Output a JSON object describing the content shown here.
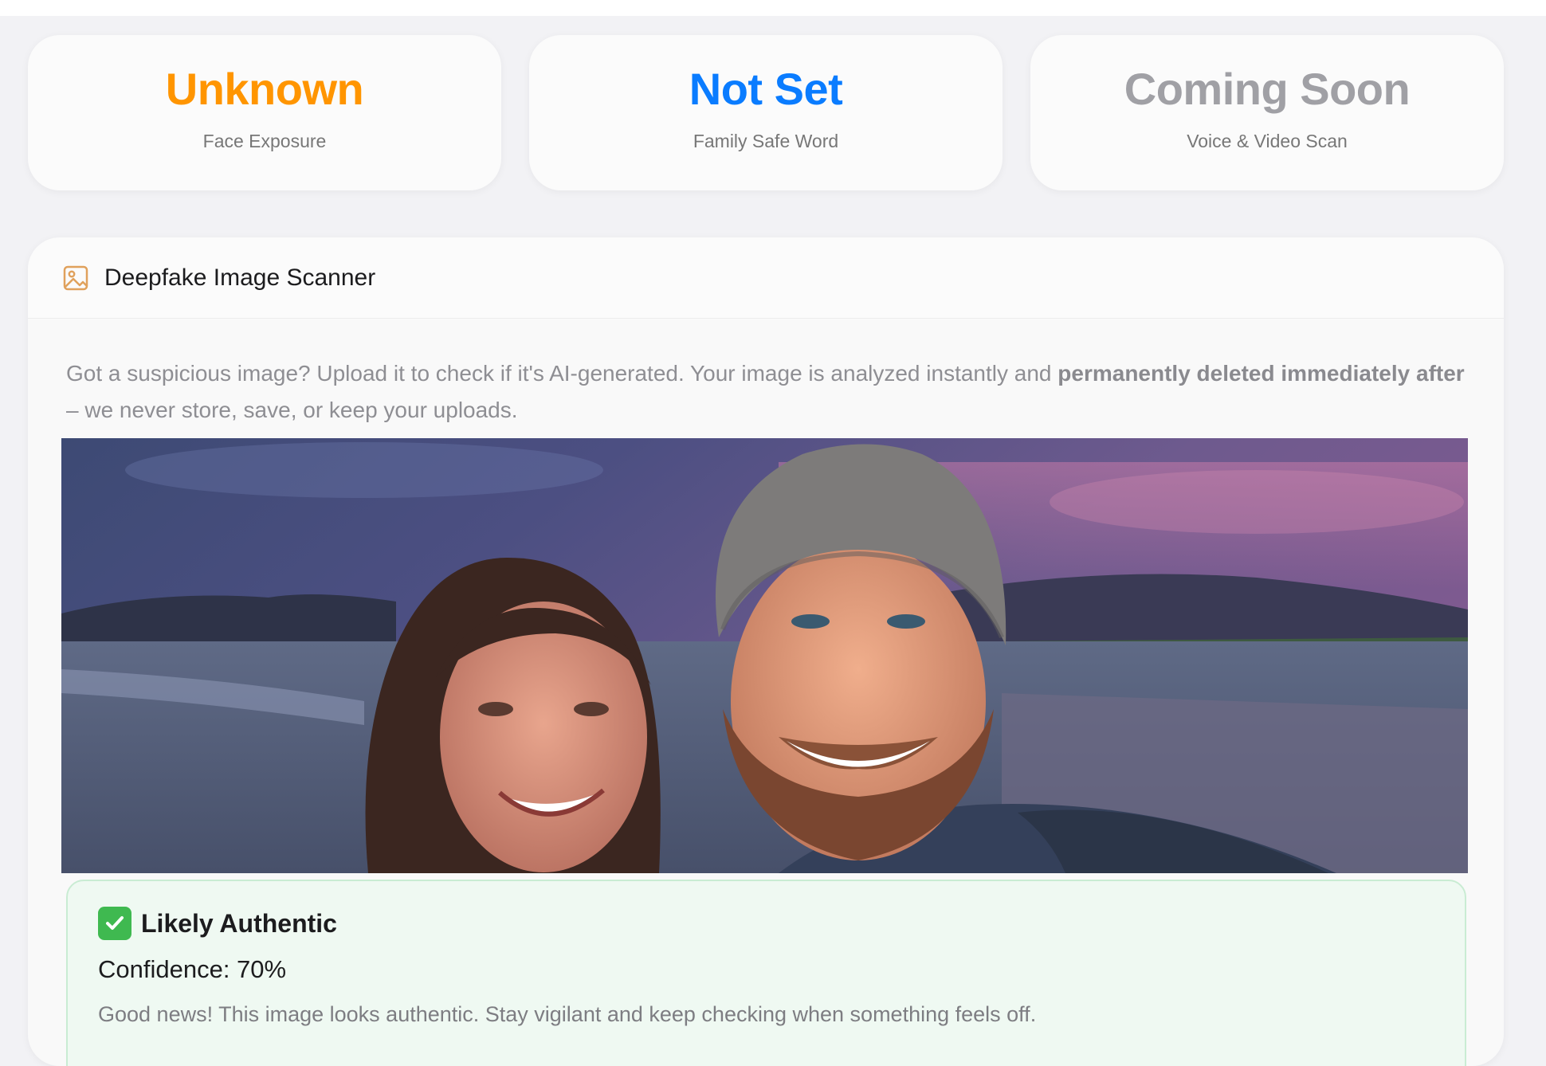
{
  "stats": [
    {
      "value": "Unknown",
      "label": "Face Exposure",
      "color": "#ff9500"
    },
    {
      "value": "Not Set",
      "label": "Family Safe Word",
      "color": "#0a7cff"
    },
    {
      "value": "Coming Soon",
      "label": "Voice & Video Scan",
      "color": "#a0a0a5"
    }
  ],
  "scanner": {
    "icon": "image-icon",
    "title": "Deepfake Image Scanner",
    "desc_part1": "Got a suspicious image? Upload it to check if it's AI-generated. Your image is analyzed instantly and ",
    "desc_bold": "permanently deleted immediately after",
    "desc_part2": " – we never store, save, or keep your uploads."
  },
  "result": {
    "icon": "check-mark-icon",
    "title": "Likely Authentic",
    "confidence": "Confidence: 70%",
    "message": "Good news! This image looks authentic. Stay vigilant and keep checking when something feels off."
  }
}
